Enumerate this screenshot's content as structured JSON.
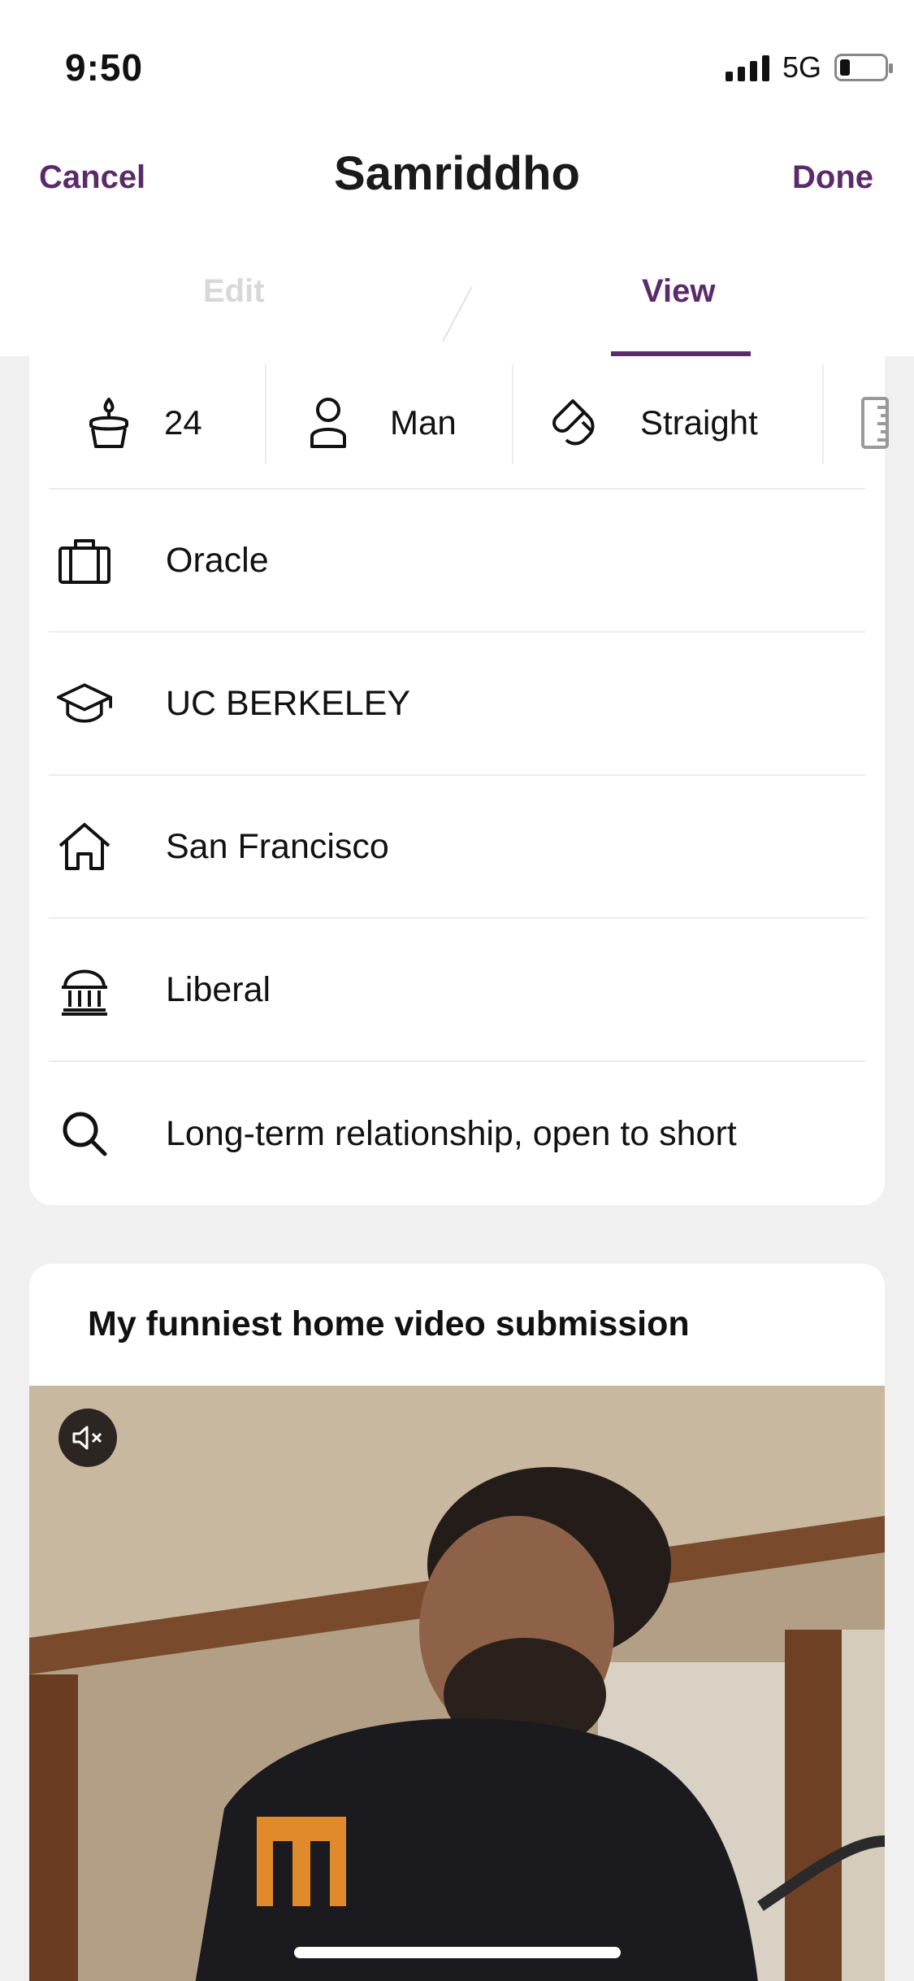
{
  "status_bar": {
    "time": "9:50",
    "network": "5G",
    "battery_level": 0.15
  },
  "header": {
    "cancel_label": "Cancel",
    "title": "Samriddho",
    "done_label": "Done"
  },
  "tabs": {
    "edit_label": "Edit",
    "view_label": "View",
    "active": "View"
  },
  "vitals": [
    {
      "icon": "cake-icon",
      "label": "24"
    },
    {
      "icon": "person-icon",
      "label": "Man"
    },
    {
      "icon": "magnet-icon",
      "label": "Straight"
    },
    {
      "icon": "ruler-icon",
      "label": ""
    }
  ],
  "info_rows": [
    {
      "icon": "briefcase-icon",
      "label": "Oracle"
    },
    {
      "icon": "graduation-cap-icon",
      "label": "UC BERKELEY"
    },
    {
      "icon": "home-icon",
      "label": "San Francisco"
    },
    {
      "icon": "capitol-icon",
      "label": "Liberal"
    },
    {
      "icon": "search-icon",
      "label": "Long-term relationship, open to short"
    }
  ],
  "prompt": {
    "title": "My funniest home video submission",
    "media_icon": "mute-icon"
  },
  "colors": {
    "accent": "#5b2a6b",
    "tab_inactive": "#d8d8d8",
    "background": "#f0f0f0"
  }
}
